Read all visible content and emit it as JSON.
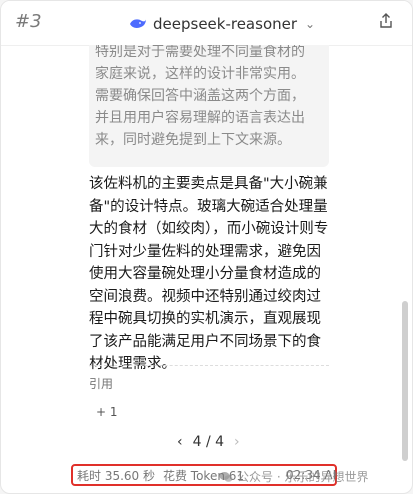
{
  "header": {
    "conversation_id": "#3",
    "model_name": "deepseek-reasoner",
    "model_icon": "whale-icon",
    "dropdown_icon": "chevron-down-icon",
    "share_icon": "share-icon"
  },
  "quote": {
    "text": "特别是对于需要处理不同量食材的家庭来说，这样的设计非常实用。需要确保回答中涵盖这两个方面，并且用用户容易理解的语言表达出来，同时避免提到上下文来源。"
  },
  "answer": {
    "text": "该佐料机的主要卖点是具备\"大小碗兼备\"的设计特点。玻璃大碗适合处理量大的食材（如绞肉），而小碗设计则专门针对少量佐料的处理需求，避免因使用大容量碗处理小分量食材造成的空间浪费。视频中还特别通过绞肉过程中碗具切换的实机演示，直观展现了该产品能满足用户不同场景下的食材处理需求。"
  },
  "citations": {
    "label": "引用",
    "more": "+ 1"
  },
  "pager": {
    "prev": "‹",
    "current": "4 / 4",
    "next": "›"
  },
  "footer": {
    "duration": "耗时 35.60 秒",
    "tokens": "花费 Token 61",
    "time": "02:34 AM"
  },
  "watermark": {
    "text": "公众号 · 乐乐的异想世界"
  }
}
